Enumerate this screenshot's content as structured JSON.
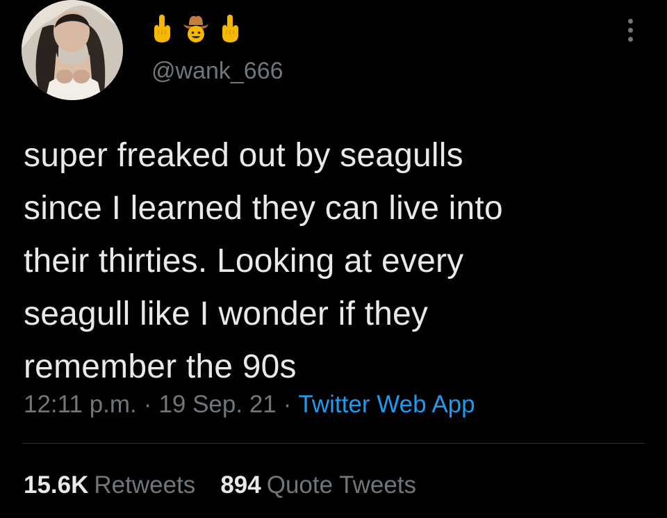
{
  "user": {
    "display_name_emojis": [
      "middle-finger-emoji",
      "cowboy-face-emoji",
      "middle-finger-emoji"
    ],
    "handle": "@wank_666"
  },
  "tweet": {
    "text": "super freaked out by seagulls\nsince I learned they can live into\ntheir thirties. Looking at every\nseagull like I wonder if they\nremember the 90s",
    "time": "12:11 p.m.",
    "date": "19 Sep. 21",
    "separator": "·",
    "source": "Twitter Web App"
  },
  "stats": {
    "retweets_count": "15.6K",
    "retweets_label": "Retweets",
    "quotes_count": "894",
    "quotes_label": "Quote Tweets"
  },
  "colors": {
    "background": "#000000",
    "text": "#e7e9ea",
    "secondary": "#71767b",
    "link": "#1d9bf0",
    "divider": "#2f3336"
  }
}
